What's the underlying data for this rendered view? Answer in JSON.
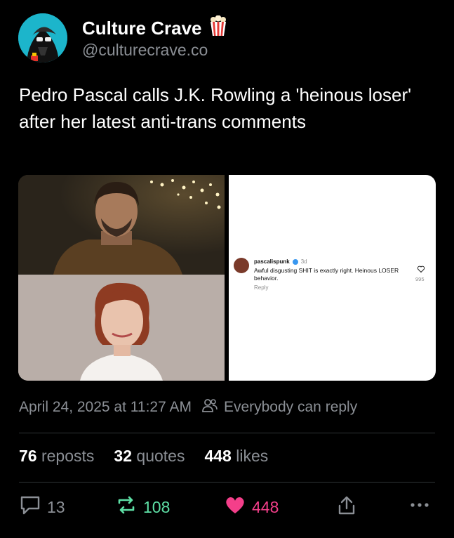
{
  "author": {
    "display_name": "Culture Crave",
    "badge_icon": "popcorn-icon",
    "handle": "@culturecrave.co"
  },
  "tweet": {
    "text": "Pedro Pascal calls J.K. Rowling a 'heinous loser' after her latest anti-trans comments"
  },
  "media": {
    "comment": {
      "username": "pascalispunk",
      "age": "3d",
      "text": "Awful disgusting SHIT is exactly right. Heinous LOSER behavior.",
      "reply_label": "Reply",
      "like_count": "995"
    }
  },
  "meta": {
    "timestamp": "April 24, 2025 at 11:27 AM",
    "audience": "Everybody can reply"
  },
  "stats": {
    "reposts_count": "76",
    "reposts_label": "reposts",
    "quotes_count": "32",
    "quotes_label": "quotes",
    "likes_count": "448",
    "likes_label": "likes"
  },
  "actions": {
    "reply_count": "13",
    "repost_count": "108",
    "like_count": "448"
  },
  "colors": {
    "background": "#000000",
    "secondary_text": "#8b8f95",
    "repost_green": "#5ee0a6",
    "like_pink": "#f43f8a"
  }
}
